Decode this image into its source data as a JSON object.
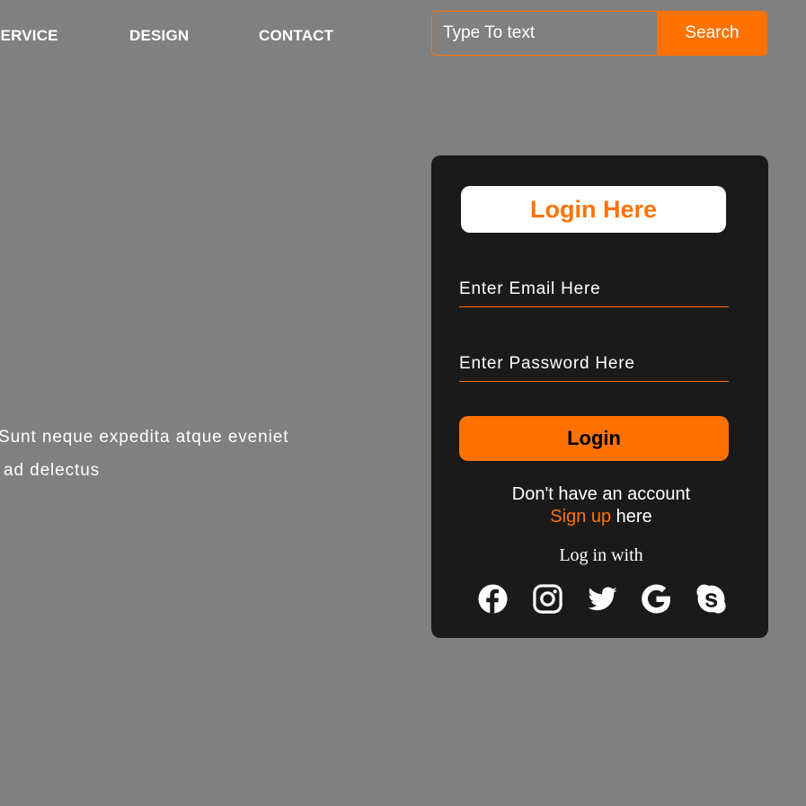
{
  "nav": {
    "items": [
      {
        "label": "SERVICE"
      },
      {
        "label": "DESIGN"
      },
      {
        "label": "CONTACT"
      }
    ]
  },
  "search": {
    "placeholder": "Type To text",
    "button_label": "Search"
  },
  "content": {
    "line1": "Sunt neque expedita atque eveniet",
    "line2": "ad delectus"
  },
  "login": {
    "title": "Login Here",
    "email_placeholder": "Enter Email Here",
    "password_placeholder": "Enter Password Here",
    "button_label": "Login",
    "no_account_text": "Don't have an account",
    "signup_link": "Sign up",
    "signup_suffix": " here",
    "login_with_text": "Log in with",
    "social_icons": [
      "facebook-icon",
      "instagram-icon",
      "twitter-icon",
      "google-icon",
      "skype-icon"
    ]
  },
  "colors": {
    "background": "#808080",
    "accent": "#ff7200",
    "card": "#1a1a1a",
    "text": "#ffffff"
  }
}
